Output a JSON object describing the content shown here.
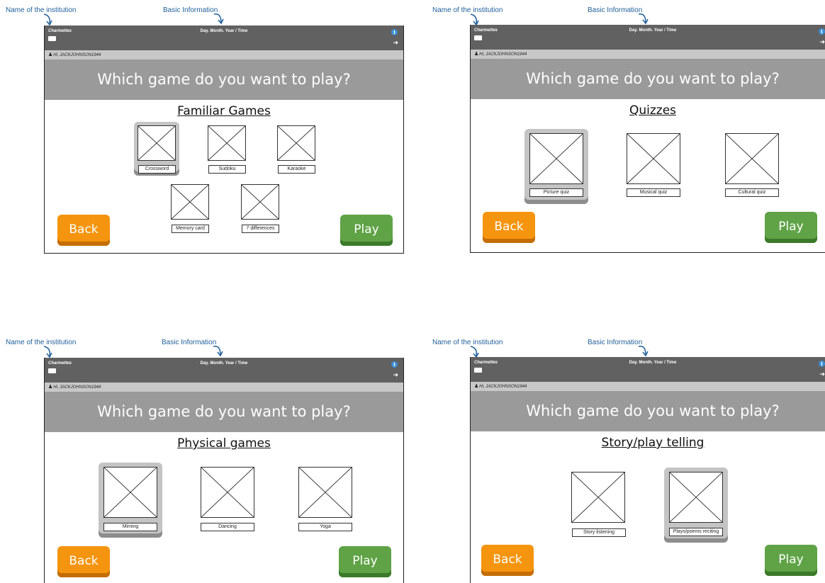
{
  "annotations": {
    "institution": "Name of the institution",
    "basic_info": "Basic Information"
  },
  "common": {
    "institution_name": "Charmettes",
    "datetime": "Day. Month. Year / Time",
    "user_greeting": "Hi, JACKJOHNSON1944",
    "question": "Which game do you want to play?",
    "back_label": "Back",
    "play_label": "Play"
  },
  "icons": {
    "battery": "battery-icon",
    "info": "info-icon",
    "logout": "logout-icon",
    "user": "user-icon"
  },
  "colors": {
    "topbar": "#616161",
    "headband": "#9a9a9a",
    "back": "#f5950f",
    "play": "#5fa346",
    "annotation": "#1f5f9a"
  },
  "screens": [
    {
      "category": "Familiar Games",
      "games": [
        "Crossword",
        "Sudoku",
        "Karaoke",
        "Memory card",
        "7 differences"
      ],
      "selected": "Crossword"
    },
    {
      "category": "Quizzes",
      "games": [
        "Picture quiz",
        "Musical quiz",
        "Cultural quiz"
      ],
      "selected": "Picture quiz"
    },
    {
      "category": "Physical games",
      "games": [
        "Miming",
        "Dancing",
        "Yoga"
      ],
      "selected": "Miming"
    },
    {
      "category": "Story/play telling",
      "games": [
        "Story listening",
        "Plays/poems reciting"
      ],
      "selected": "Plays/poems reciting"
    }
  ]
}
